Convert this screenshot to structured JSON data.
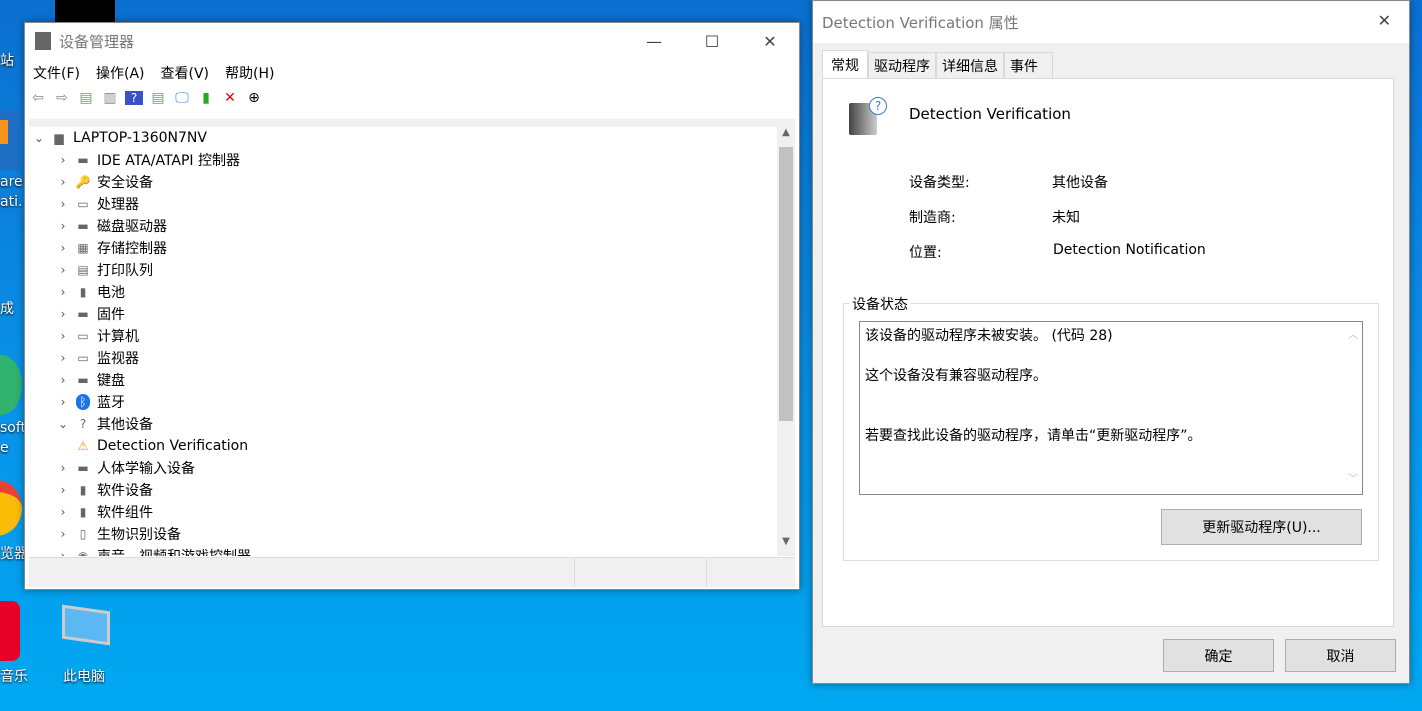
{
  "desktop": {
    "icons": [
      "站",
      "are",
      "ati.",
      "成",
      "soft",
      "e",
      "览器",
      "音乐",
      "此电脑"
    ]
  },
  "device_manager": {
    "title": "设备管理器",
    "menu": [
      "文件(F)",
      "操作(A)",
      "查看(V)",
      "帮助(H)"
    ],
    "root": "LAPTOP-1360N7NV",
    "items": [
      {
        "label": "IDE ATA/ATAPI 控制器",
        "icon": "ide-icon"
      },
      {
        "label": "安全设备",
        "icon": "security-icon"
      },
      {
        "label": "处理器",
        "icon": "cpu-icon"
      },
      {
        "label": "磁盘驱动器",
        "icon": "disk-icon"
      },
      {
        "label": "存储控制器",
        "icon": "storage-icon"
      },
      {
        "label": "打印队列",
        "icon": "printer-icon"
      },
      {
        "label": "电池",
        "icon": "battery-icon"
      },
      {
        "label": "固件",
        "icon": "firmware-icon"
      },
      {
        "label": "计算机",
        "icon": "computer-icon"
      },
      {
        "label": "监视器",
        "icon": "monitor-icon"
      },
      {
        "label": "键盘",
        "icon": "keyboard-icon"
      },
      {
        "label": "蓝牙",
        "icon": "bluetooth-icon"
      },
      {
        "label": "其他设备",
        "icon": "unknown-device-icon",
        "expanded": true
      },
      {
        "label": "Detection Verification",
        "icon": "warning-device-icon",
        "child": true
      },
      {
        "label": "人体学输入设备",
        "icon": "hid-icon"
      },
      {
        "label": "软件设备",
        "icon": "software-device-icon"
      },
      {
        "label": "软件组件",
        "icon": "software-component-icon"
      },
      {
        "label": "生物识别设备",
        "icon": "fingerprint-icon"
      },
      {
        "label": "声音、视频和游戏控制器",
        "icon": "audio-icon"
      }
    ]
  },
  "properties": {
    "title": "Detection Verification 属性",
    "tabs": [
      "常规",
      "驱动程序",
      "详细信息",
      "事件"
    ],
    "device_name": "Detection Verification",
    "fields": [
      {
        "label": "设备类型:",
        "value": "其他设备"
      },
      {
        "label": "制造商:",
        "value": "未知"
      },
      {
        "label": "位置:",
        "value": "Detection Notification"
      }
    ],
    "status_title": "设备状态",
    "status_lines": [
      "该设备的驱动程序未被安装。 (代码 28)",
      "",
      "这个设备没有兼容驱动程序。",
      "",
      "",
      "若要查找此设备的驱动程序，请单击“更新驱动程序”。"
    ],
    "update_button": "更新驱动程序(U)...",
    "ok": "确定",
    "cancel": "取消"
  }
}
